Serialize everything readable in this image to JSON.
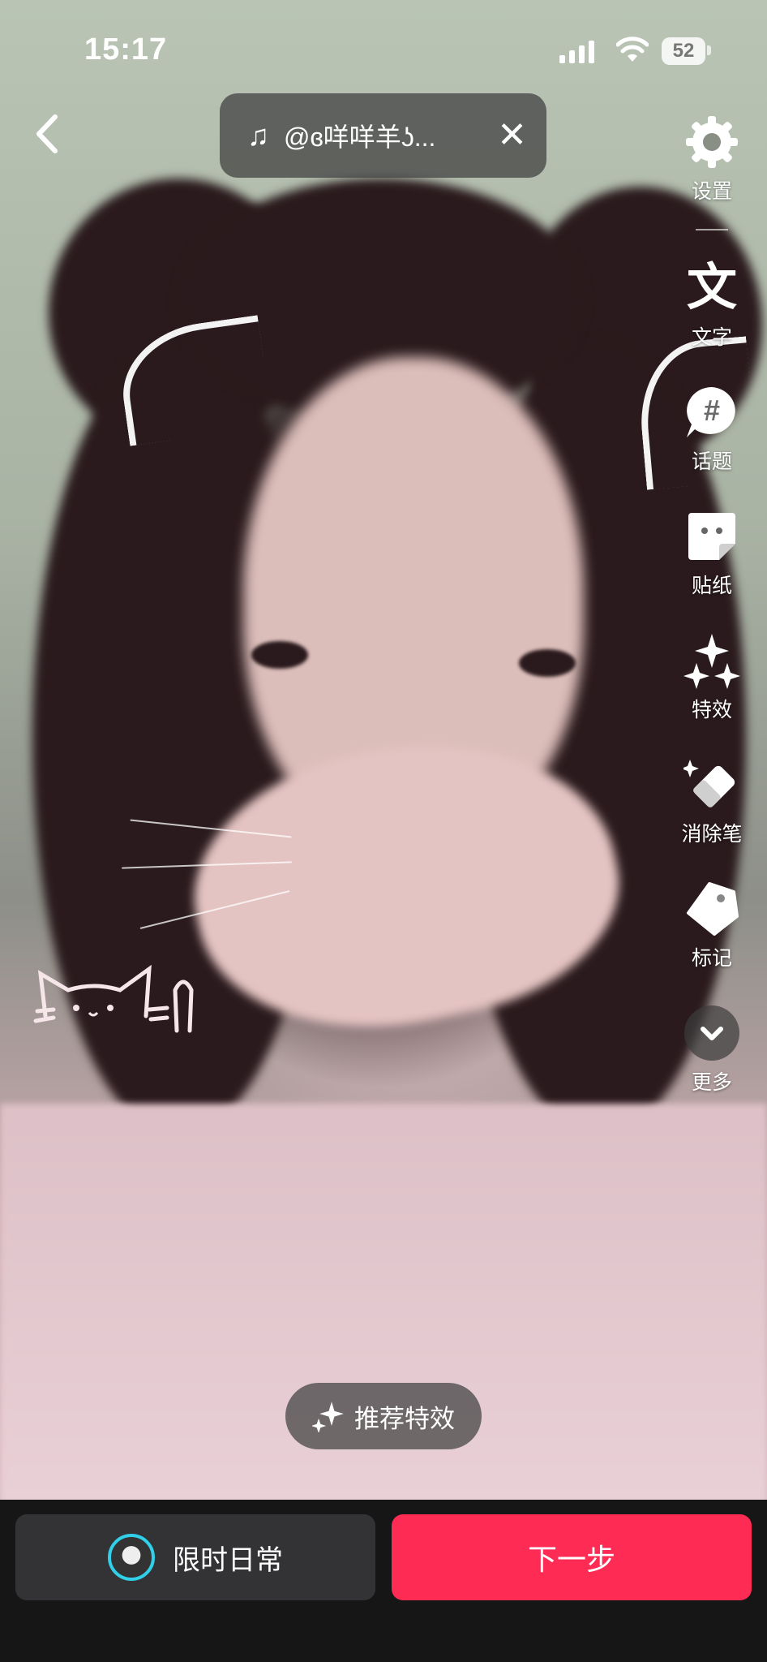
{
  "status_bar": {
    "time": "15:17",
    "battery": "52"
  },
  "music": {
    "label": "@ɞ咩咩羊ʖ...",
    "note_icon": "music-note-icon",
    "close_icon": "close-icon"
  },
  "sidebar": {
    "items": [
      {
        "label": "设置",
        "icon": "gear-icon"
      },
      {
        "label": "文字",
        "icon": "text-icon"
      },
      {
        "label": "话题",
        "icon": "hashtag-icon"
      },
      {
        "label": "贴纸",
        "icon": "sticker-icon"
      },
      {
        "label": "特效",
        "icon": "sparkle-icon"
      },
      {
        "label": "消除笔",
        "icon": "eraser-icon"
      },
      {
        "label": "标记",
        "icon": "tag-icon"
      },
      {
        "label": "更多",
        "icon": "chevron-down-icon"
      }
    ],
    "text_glyph": "文",
    "hashtag_glyph": "#"
  },
  "recommend": {
    "label": "推荐特效"
  },
  "bottom": {
    "daily_label": "限时日常",
    "next_label": "下一步"
  },
  "colors": {
    "accent": "#fe2c55",
    "pill_bg": "#333335"
  }
}
